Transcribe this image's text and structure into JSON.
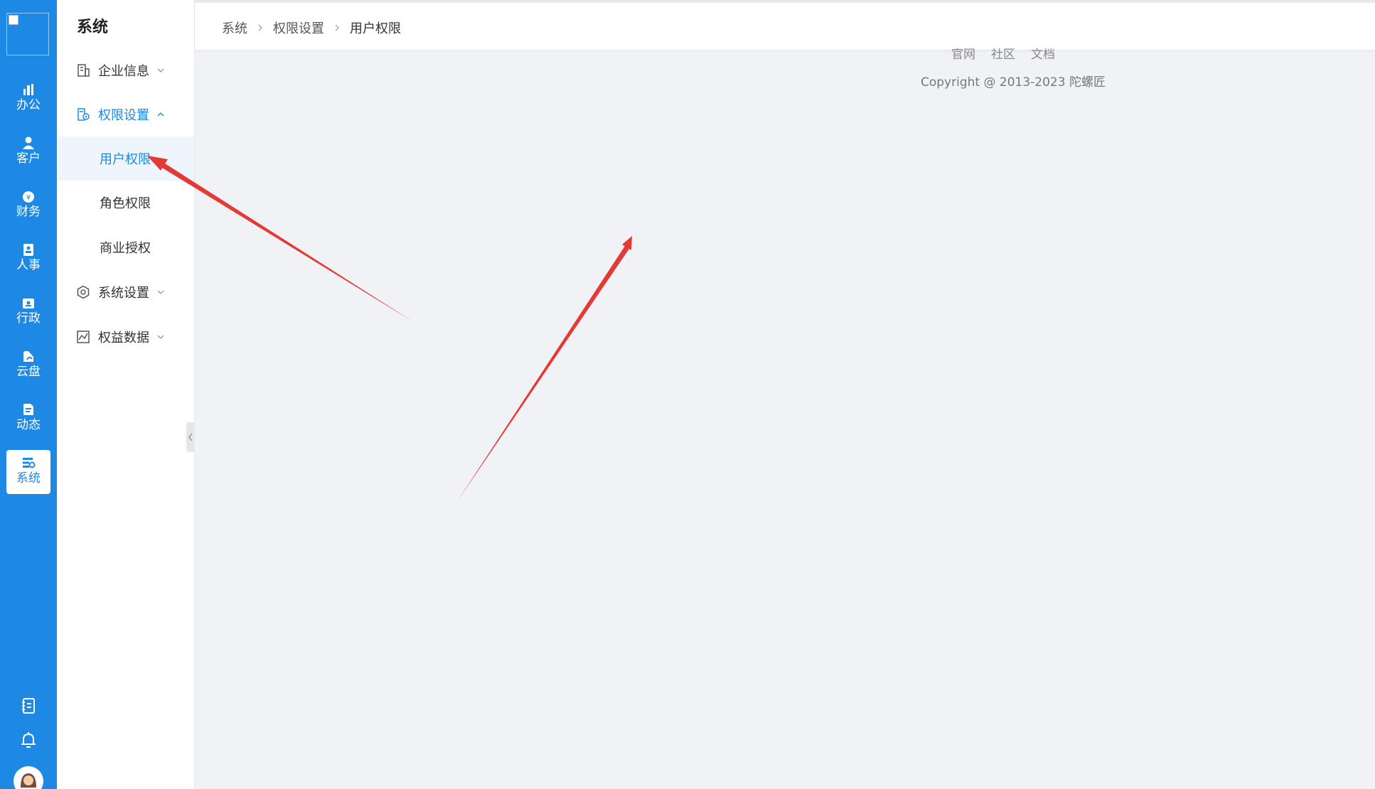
{
  "rail": {
    "items": [
      {
        "label": "办公",
        "icon": "office-icon"
      },
      {
        "label": "客户",
        "icon": "customer-icon"
      },
      {
        "label": "财务",
        "icon": "finance-icon"
      },
      {
        "label": "人事",
        "icon": "hr-icon"
      },
      {
        "label": "行政",
        "icon": "admin-icon"
      },
      {
        "label": "云盘",
        "icon": "cloud-disk-icon"
      },
      {
        "label": "动态",
        "icon": "feed-icon"
      },
      {
        "label": "系统",
        "icon": "system-icon",
        "active": true
      }
    ],
    "bottom_icons": [
      "notebook-icon",
      "bell-icon"
    ]
  },
  "submenu": {
    "title": "系统",
    "items": [
      {
        "label": "企业信息",
        "icon": "building-icon",
        "expanded": false
      },
      {
        "label": "权限设置",
        "icon": "permission-icon",
        "expanded": true,
        "children": [
          {
            "label": "用户权限",
            "active": true
          },
          {
            "label": "角色权限"
          },
          {
            "label": "商业授权"
          }
        ]
      },
      {
        "label": "系统设置",
        "icon": "settings-icon",
        "expanded": false
      },
      {
        "label": "权益数据",
        "icon": "chart-icon",
        "expanded": false
      }
    ]
  },
  "breadcrumb": [
    "系统",
    "权限设置",
    "用户权限"
  ],
  "footer": {
    "links": [
      "官网",
      "社区",
      "文档"
    ],
    "copyright": "Copyright @ 2013-2023 陀螺匠"
  },
  "colors": {
    "primary": "#1e88e5",
    "background": "#f0f2f5",
    "annotation": "#e53935"
  }
}
